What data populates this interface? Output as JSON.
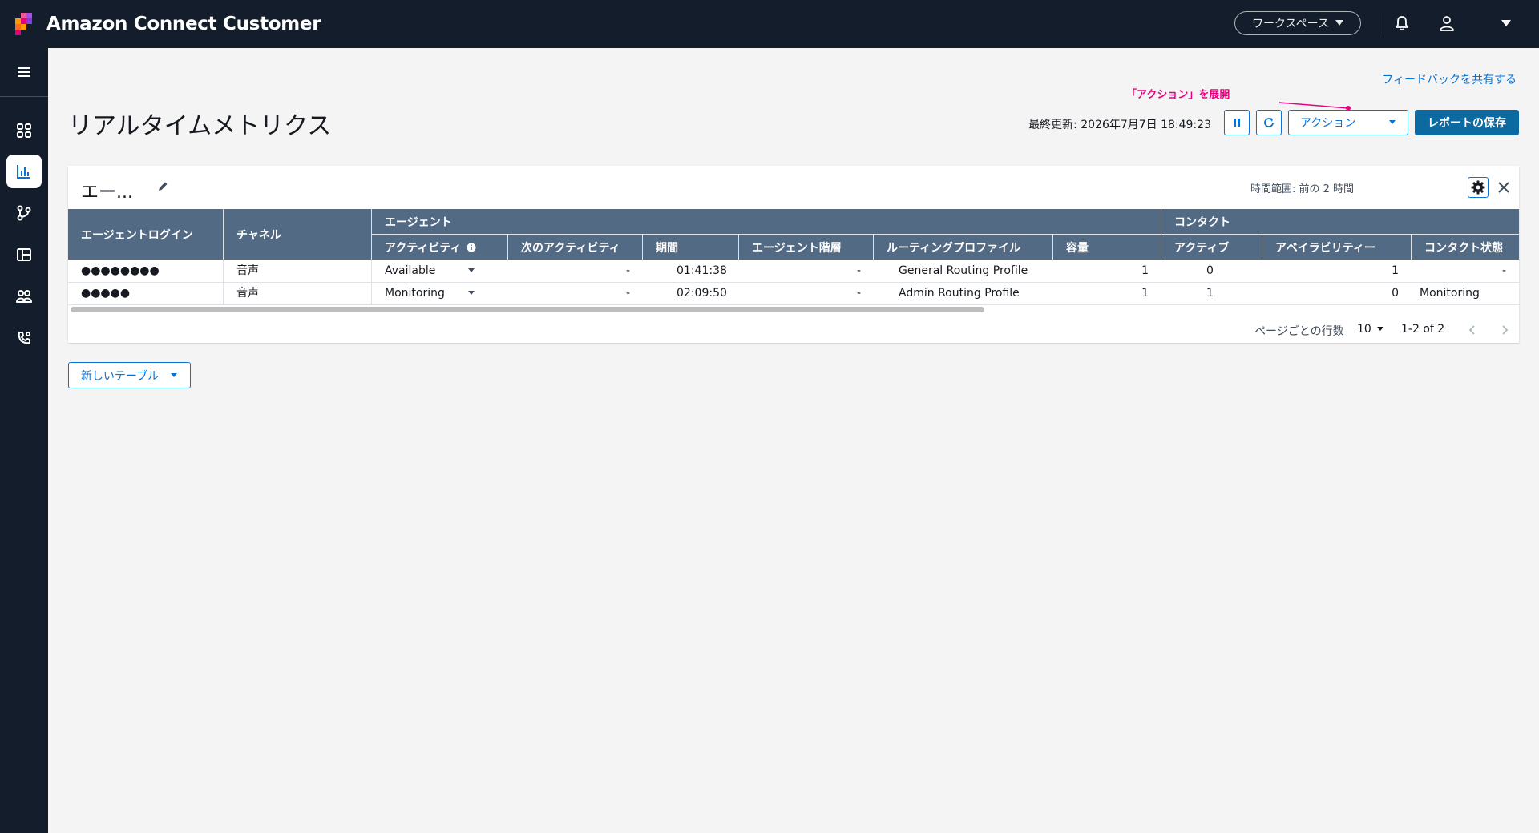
{
  "topbar": {
    "app_title": "Amazon Connect Customer",
    "workspace_label": "ワークスペース"
  },
  "header": {
    "feedback_link": "フィードバックを共有する",
    "annotation": "「アクション」を展開",
    "page_title": "リアルタイムメトリクス",
    "last_updated": "最終更新: 2026年7月7日 18:49:23",
    "actions_label": "アクション",
    "save_report_label": "レポートの保存"
  },
  "card": {
    "title": "エー...",
    "time_range": "時間範囲: 前の 2 時間",
    "group_headers": {
      "agent_login": "エージェントログイン",
      "channel": "チャネル",
      "agent": "エージェント",
      "contact": "コンタクト"
    },
    "columns": {
      "activity": "アクティビティ",
      "next_activity": "次のアクティビティ",
      "duration": "期間",
      "agent_hierarchy": "エージェント階層",
      "routing_profile": "ルーティングプロファイル",
      "capacity": "容量",
      "active": "アクティブ",
      "availability": "アベイラビリティー",
      "contact_state": "コンタクト状態"
    },
    "rows": [
      {
        "login": "●●●●●●●●",
        "channel": "音声",
        "activity": "Available",
        "next_activity": "-",
        "duration": "01:41:38",
        "hierarchy": "-",
        "routing_profile": "General Routing Profile",
        "capacity": "1",
        "active": "0",
        "availability": "1",
        "contact_state": "-"
      },
      {
        "login": "●●●●●",
        "channel": "音声",
        "activity": "Monitoring",
        "next_activity": "-",
        "duration": "02:09:50",
        "hierarchy": "-",
        "routing_profile": "Admin Routing Profile",
        "capacity": "1",
        "active": "1",
        "availability": "0",
        "contact_state": "Monitoring"
      }
    ],
    "pagination": {
      "rows_per_page_label": "ページごとの行数",
      "rows_per_page": "10",
      "range": "1-2 of 2"
    }
  },
  "new_table_label": "新しいテーブル",
  "colors": {
    "topbar": "#131d2b",
    "accent": "#0972d3",
    "primary_button": "#0d6aa0",
    "table_header": "#536a85",
    "annotation": "#e6007e"
  }
}
